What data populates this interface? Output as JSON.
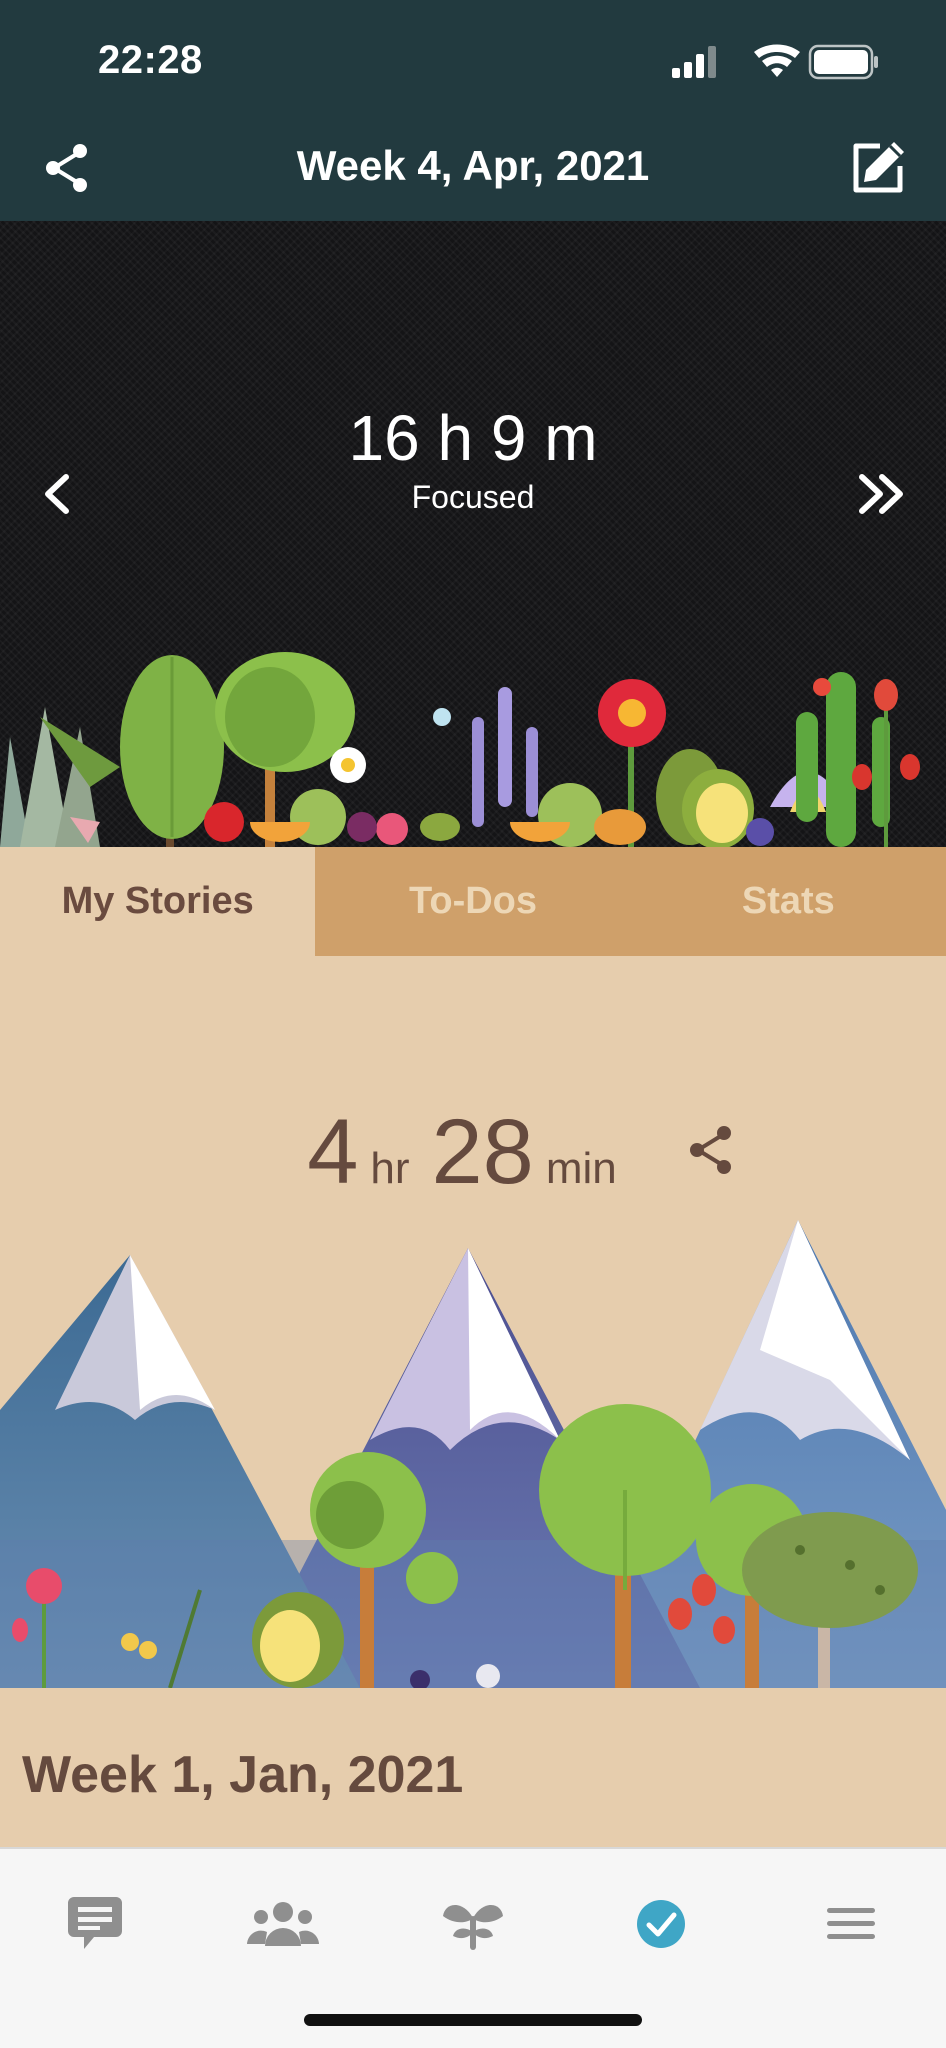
{
  "status_bar": {
    "time": "22:28"
  },
  "header": {
    "title": "Week 4, Apr, 2021",
    "share_icon": "share-icon",
    "edit_icon": "edit-icon"
  },
  "hero": {
    "focus_time": "16 h 9 m",
    "focus_label": "Focused",
    "prev_icon": "chevron-left-icon",
    "next_icon": "double-chevron-right-icon"
  },
  "tabs": [
    {
      "label": "My Stories",
      "active": true
    },
    {
      "label": "To-Dos",
      "active": false
    },
    {
      "label": "Stats",
      "active": false
    }
  ],
  "story": {
    "hours": "4",
    "hours_unit": "hr",
    "minutes": "28",
    "minutes_unit": "min",
    "share_icon": "share-icon"
  },
  "next_week_label": "Week 1, Jan, 2021",
  "bottom_nav": [
    {
      "icon": "chat-icon",
      "selected": false
    },
    {
      "icon": "friends-icon",
      "selected": false
    },
    {
      "icon": "plant-icon",
      "selected": false
    },
    {
      "icon": "check-circle-icon",
      "selected": true
    },
    {
      "icon": "menu-icon",
      "selected": false
    }
  ],
  "colors": {
    "header_bg": "#223A3F",
    "tab_bar": "#CFA06A",
    "content_bg": "#E6CDAD",
    "text_brown": "#654A3E",
    "accent_teal": "#3FA6C6"
  }
}
